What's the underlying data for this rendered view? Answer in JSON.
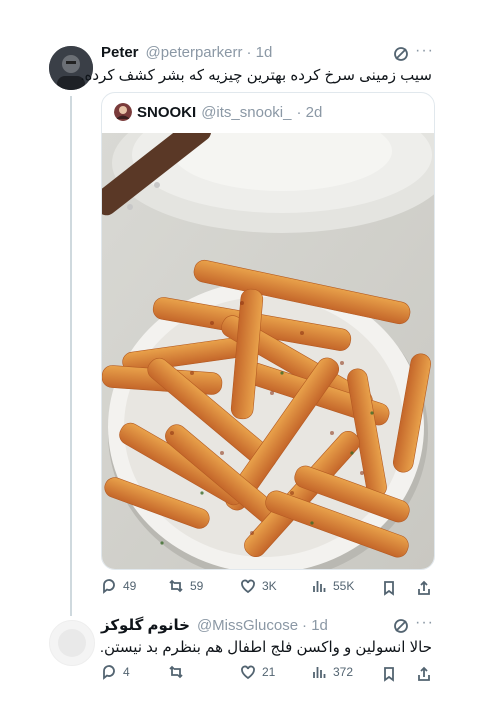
{
  "tweet": {
    "author_name": "Peter",
    "author_handle": "@peterparkerr",
    "time": "· 1d",
    "text": "سیب زمینی سرخ کرده بهترین چیزیه که بشر کشف کرده.",
    "quote": {
      "author_name": "SNOOKI",
      "author_handle": "@its_snooki_",
      "time": "· 2d",
      "image_alt": "bowl of seasoned french fries"
    },
    "stats": {
      "replies": "49",
      "retweets": "59",
      "likes": "3K",
      "views": "55K"
    }
  },
  "reply": {
    "author_name": "خانوم گلوکز",
    "author_handle": "@MissGlucose",
    "time": "· 1d",
    "text": "حالا انسولین و واکسن فلج اطفال هم بنظرم بد نیستن.",
    "stats": {
      "replies": "4",
      "retweets": "",
      "likes": "21",
      "views": "372"
    }
  },
  "colors": {
    "muted": "#536471",
    "handle": "#8b98a5",
    "border": "#e1e8ed",
    "thread": "#cfd9de"
  }
}
